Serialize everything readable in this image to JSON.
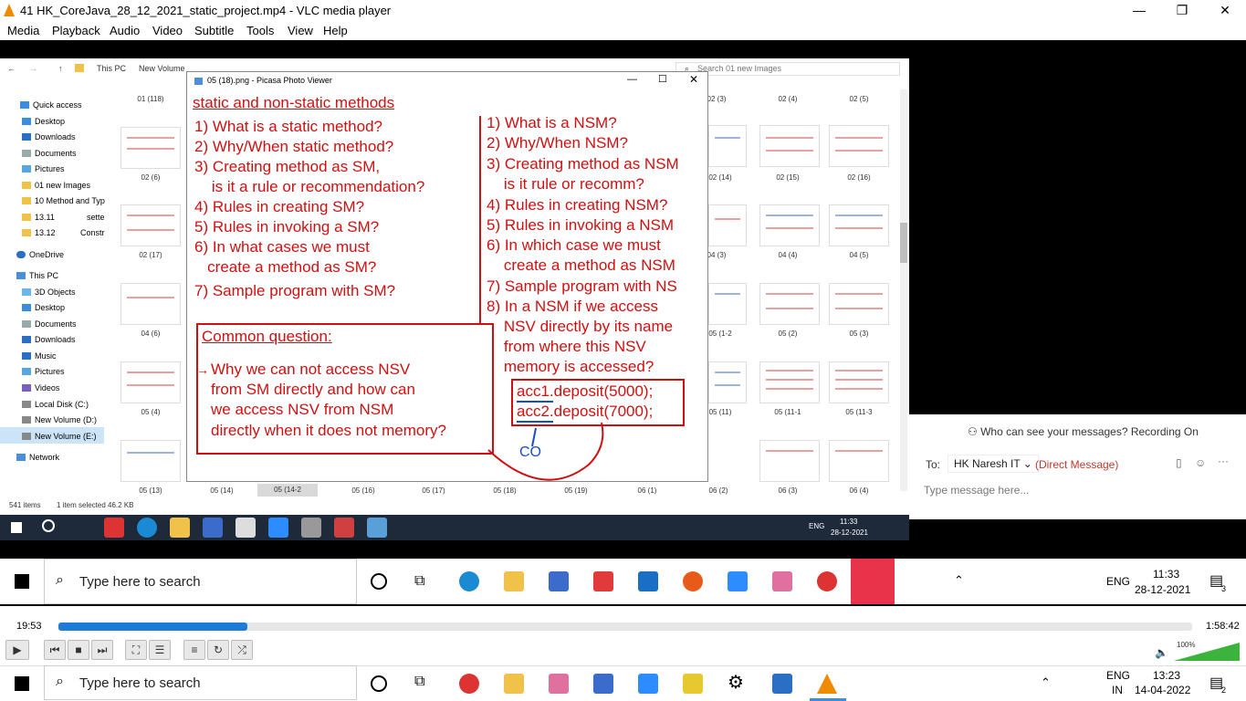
{
  "vlc": {
    "title": "41 HK_CoreJava_28_12_2021_static_project.mp4 - VLC media player",
    "menu": [
      "Media",
      "Playback",
      "Audio",
      "Video",
      "Subtitle",
      "Tools",
      "View",
      "Help"
    ],
    "elapsed": "19:53",
    "total": "1:58:42",
    "progress": 0.167,
    "volume": "100%"
  },
  "explorer": {
    "path": [
      "This PC",
      "New Volume"
    ],
    "search": "Search 01 new Images",
    "status": "541 items",
    "selected": "1 item selected  46.2 KB",
    "nav": [
      "Quick access",
      "Desktop",
      "Downloads",
      "Documents",
      "Pictures",
      "01 new Images",
      "10 Method and Typ",
      "13.11",
      "13.12",
      "OneDrive",
      "This PC",
      "3D Objects",
      "Desktop",
      "Documents",
      "Downloads",
      "Music",
      "Pictures",
      "Videos",
      "Local Disk (C:)",
      "New Volume (D:)",
      "New Volume (E:)",
      "Network"
    ],
    "nav_extra": {
      "sette": "sette",
      "constr": "Constr"
    },
    "left_labels": [
      "01 (118)",
      "02 (6)",
      "02 (17)",
      "04 (6)",
      "05 (4)"
    ],
    "right_labels": [
      "02 (3)",
      "02 (4)",
      "02 (5)",
      "02 (14)",
      "02 (15)",
      "02 (16)",
      "04 (3)",
      "04 (4)",
      "04 (5)",
      "05 (1-2",
      "05 (2)",
      "05 (3)",
      "05 (11)",
      "05 (11-1",
      "05 (11-3"
    ],
    "bottom_labels": [
      "05 (13)",
      "05 (14)",
      "05 (14-2",
      "05 (16)",
      "05 (17)",
      "05 (18)",
      "05 (19)",
      "06 (1)",
      "06 (2)",
      "06 (3)",
      "06 (4)"
    ]
  },
  "picasa": {
    "title": "05 (18).png - Picasa Photo Viewer",
    "heading": "static and non-static methods",
    "left": [
      "1) What is a static method?",
      "2) Why/When static method?",
      "3) Creating method as SM,",
      "    is it a rule or recommendation?",
      "4) Rules in creating SM?",
      "5) Rules in invoking a SM?",
      "6) In what cases we must",
      "   create a method as SM?",
      "7) Sample program with SM?"
    ],
    "right": [
      "1) What is a NSM?",
      "2) Why/When NSM?",
      "3) Creating method as NSM",
      "    is it rule or recomm?",
      "4) Rules in creating NSM?",
      "5) Rules in invoking a NSM",
      "6) In which case we must",
      "    create a method as NSM",
      "7) Sample program with NS",
      "8) In a NSM if we access",
      "    NSV directly by its name",
      "    from where this NSV",
      "    memory is accessed?"
    ],
    "common_title": "Common question:",
    "common": [
      "Why we can not access NSV",
      "from SM directly and how can",
      "we access NSV from NSM",
      "directly when it does not memory?"
    ],
    "code": [
      "acc1.deposit(5000);",
      "acc2.deposit(7000);"
    ],
    "note": "CO"
  },
  "teams": {
    "privacy": "Who can see your messages? Recording On",
    "to_label": "To:",
    "recipient": "HK Naresh IT",
    "dm": "(Direct Message)",
    "placeholder": "Type message here..."
  },
  "inner_tray": {
    "lang": "ENG",
    "time": "11:33",
    "date": "28-12-2021"
  },
  "inner_tb2": {
    "search": "Type here to search",
    "lang": "ENG",
    "time": "11:33",
    "date": "28-12-2021",
    "notif": "3"
  },
  "taskbar": {
    "search": "Type here to search",
    "lang1": "ENG",
    "lang2": "IN",
    "time": "13:23",
    "date": "14-04-2022",
    "notif": "2"
  },
  "colors": {
    "accent": "#d01010",
    "blue": "#1a4fc0",
    "seek": "#1e7bd6"
  }
}
